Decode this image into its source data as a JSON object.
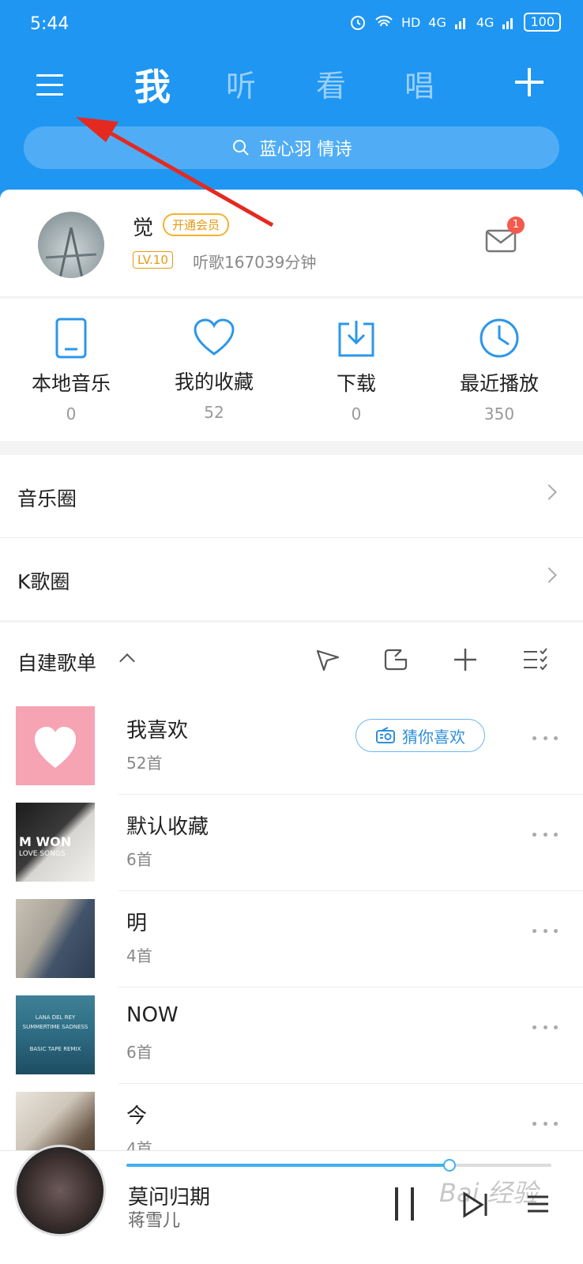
{
  "status_bar": {
    "time": "5:44",
    "network": "HD",
    "signal_1": "4G",
    "signal_2": "4G",
    "battery": "100"
  },
  "top_nav": {
    "tabs": [
      {
        "label": "我",
        "active": true
      },
      {
        "label": "听",
        "active": false
      },
      {
        "label": "看",
        "active": false
      },
      {
        "label": "唱",
        "active": false
      }
    ],
    "accent": "#1f96f2"
  },
  "search": {
    "placeholder": "蓝心羽 情诗"
  },
  "profile": {
    "username": "觉",
    "vip_label": "开通会员",
    "level": "LV.10",
    "listen_time": "听歌167039分钟",
    "mail_badge": "1"
  },
  "quick_actions": [
    {
      "label": "本地音乐",
      "count": "0",
      "icon": "phone-icon"
    },
    {
      "label": "我的收藏",
      "count": "52",
      "icon": "heart-icon"
    },
    {
      "label": "下载",
      "count": "0",
      "icon": "download-icon"
    },
    {
      "label": "最近播放",
      "count": "350",
      "icon": "clock-icon"
    }
  ],
  "circles": [
    {
      "label": "音乐圈"
    },
    {
      "label": "K歌圈"
    }
  ],
  "playlists_section": {
    "title": "自建歌单",
    "items": [
      {
        "name": "我喜欢",
        "count": "52首",
        "action": "猜你喜欢"
      },
      {
        "name": "默认收藏",
        "count": "6首"
      },
      {
        "name": "明",
        "count": "4首"
      },
      {
        "name": "NOW",
        "count": "6首"
      },
      {
        "name": "今",
        "count": "4首"
      }
    ],
    "covers": {
      "cover2_line1": "M WON",
      "cover2_line2": "LOVE SONGS",
      "cover4_line1": "LANA DEL REY",
      "cover4_line2": "SUMMERTIME SADNESS",
      "cover4_line3": "BASIC TAPE REMIX"
    }
  },
  "player": {
    "song": "莫问归期",
    "artist": "蒋雪儿",
    "progress": 0.76,
    "watermark": "Bai 经验"
  }
}
